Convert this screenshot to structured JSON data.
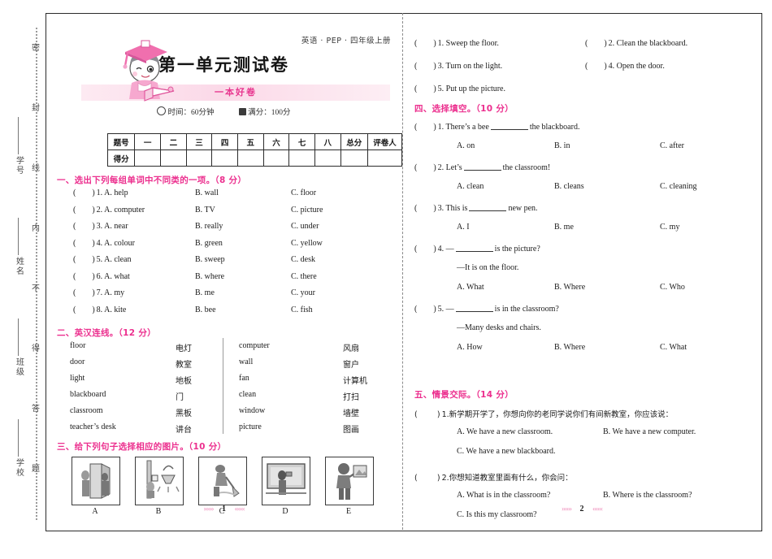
{
  "header": {
    "subject_line": "英语 · PEP · 四年级上册",
    "title": "第一单元测试卷",
    "brand": "一本好卷",
    "time_label": "时间：60分钟",
    "score_label": "满分：100分"
  },
  "score_table": {
    "row_labels": [
      "题号",
      "得分"
    ],
    "columns": [
      "一",
      "二",
      "三",
      "四",
      "五",
      "六",
      "七",
      "八",
      "总分",
      "评卷人"
    ]
  },
  "margin": {
    "seal_text": "密封线内不得答题",
    "info_labels": [
      "学号",
      "姓名",
      "班级",
      "学校"
    ]
  },
  "sections": {
    "s1": {
      "heading": "一、选出下列每组单词中不同类的一项。",
      "points": "（8 分）",
      "items": [
        {
          "n": "1",
          "a": "A. help",
          "b": "B. wall",
          "c": "C. floor"
        },
        {
          "n": "2",
          "a": "A. computer",
          "b": "B. TV",
          "c": "C. picture"
        },
        {
          "n": "3",
          "a": "A. near",
          "b": "B. really",
          "c": "C. under"
        },
        {
          "n": "4",
          "a": "A. colour",
          "b": "B. green",
          "c": "C. yellow"
        },
        {
          "n": "5",
          "a": "A. clean",
          "b": "B. sweep",
          "c": "C. desk"
        },
        {
          "n": "6",
          "a": "A. what",
          "b": "B. where",
          "c": "C. there"
        },
        {
          "n": "7",
          "a": "A. my",
          "b": "B. me",
          "c": "C. your"
        },
        {
          "n": "8",
          "a": "A. kite",
          "b": "B. bee",
          "c": "C. fish"
        }
      ]
    },
    "s2": {
      "heading": "二、英汉连线。",
      "points": "（12 分）",
      "left": [
        {
          "en": "floor",
          "zh": "电灯"
        },
        {
          "en": "door",
          "zh": "教室"
        },
        {
          "en": "light",
          "zh": "地板"
        },
        {
          "en": "blackboard",
          "zh": "门"
        },
        {
          "en": "classroom",
          "zh": "黑板"
        },
        {
          "en": "teacher’s desk",
          "zh": "讲台"
        }
      ],
      "right": [
        {
          "en": "computer",
          "zh": "风扇"
        },
        {
          "en": "wall",
          "zh": "窗户"
        },
        {
          "en": "fan",
          "zh": "计算机"
        },
        {
          "en": "clean",
          "zh": "打扫"
        },
        {
          "en": "window",
          "zh": "墙壁"
        },
        {
          "en": "picture",
          "zh": "图画"
        }
      ]
    },
    "s3": {
      "heading": "三、给下列句子选择相应的图片。",
      "points": "（10 分）",
      "picture_labels": [
        "A",
        "B",
        "C",
        "D",
        "E"
      ],
      "picture_names": [
        "open-door-scene",
        "turn-on-light-scene",
        "sweep-floor-scene",
        "clean-blackboard-scene",
        "put-up-picture-scene"
      ],
      "sentences": [
        {
          "n": "1",
          "text": "Sweep the floor."
        },
        {
          "n": "2",
          "text": "Clean the blackboard."
        },
        {
          "n": "3",
          "text": "Turn on the light."
        },
        {
          "n": "4",
          "text": "Open the door."
        },
        {
          "n": "5",
          "text": "Put up the picture."
        }
      ]
    },
    "s4": {
      "heading": "四、选择填空。",
      "points": "（10 分）",
      "items": [
        {
          "n": "1",
          "stem_a": "There’s a bee",
          "stem_b": "the blackboard.",
          "sub": "",
          "a": "A. on",
          "b": "B. in",
          "c": "C. after"
        },
        {
          "n": "2",
          "stem_a": "Let’s",
          "stem_b": "the classroom!",
          "sub": "",
          "a": "A. clean",
          "b": "B. cleans",
          "c": "C. cleaning"
        },
        {
          "n": "3",
          "stem_a": "This is",
          "stem_b": "new pen.",
          "sub": "",
          "a": "A. I",
          "b": "B. me",
          "c": "C. my"
        },
        {
          "n": "4",
          "stem_a": "—",
          "stem_b": "is the picture?",
          "sub": "—It is on the floor.",
          "a": "A. What",
          "b": "B. Where",
          "c": "C. Who"
        },
        {
          "n": "5",
          "stem_a": "—",
          "stem_b": "is in the classroom?",
          "sub": "—Many desks and chairs.",
          "a": "A. How",
          "b": "B. Where",
          "c": "C. What"
        }
      ]
    },
    "s5": {
      "heading": "五、情景交际。",
      "points": "（14 分）",
      "items": [
        {
          "n": "1",
          "prompt": "新学期开学了，你想向你的老同学说你们有间新教室，你应该说：",
          "a": "A. We have a new classroom.",
          "b": "B. We have a new computer.",
          "c": "C. We have a new blackboard."
        },
        {
          "n": "2",
          "prompt": "你想知道教室里面有什么，你会问：",
          "a": "A. What is in the classroom?",
          "b": "B. Where is the classroom?",
          "c": "C. Is this my classroom?"
        }
      ]
    }
  },
  "footer": {
    "left_page": "1",
    "right_page": "2",
    "arrows_left": "››››››",
    "arrows_right": "‹‹‹‹‹‹"
  },
  "colors": {
    "accent_pink": "#ec2f8e",
    "band_pink": "#fbd9e8",
    "ink": "#1b1b1b"
  }
}
